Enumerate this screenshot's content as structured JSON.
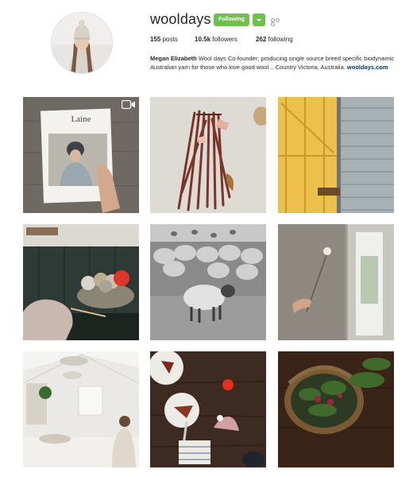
{
  "profile": {
    "username": "wooldays",
    "follow_label": "Following",
    "stats": {
      "posts_count": "155",
      "posts_label": "posts",
      "followers_count": "10.5k",
      "followers_label": "followers",
      "following_count": "262",
      "following_label": "following"
    },
    "bio": {
      "name": "Megan Elizabeth",
      "text": "Wool days Co-founder; producing single source breed specific biodynamic Australian yarn for those who love good wool .. Country Victoria, Australia.",
      "link": "wooldays.com"
    }
  },
  "posts": [
    {
      "id": "post-1",
      "cover_title": "Laine",
      "has_video": true
    },
    {
      "id": "post-2"
    },
    {
      "id": "post-3"
    },
    {
      "id": "post-4"
    },
    {
      "id": "post-5"
    },
    {
      "id": "post-6"
    },
    {
      "id": "post-7"
    },
    {
      "id": "post-8"
    },
    {
      "id": "post-9"
    }
  ],
  "colors": {
    "follow_green": "#70c050",
    "link_blue": "#003569",
    "text": "#262626"
  },
  "icons": {
    "video": "video-camera-icon",
    "more": "more-options-icon",
    "dropdown": "chevron-down-icon"
  }
}
